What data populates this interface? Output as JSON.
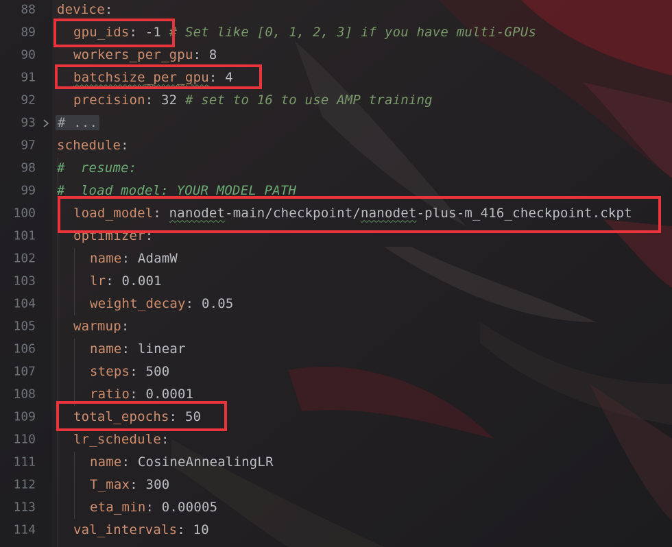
{
  "lines": [
    {
      "n": "88",
      "key": "device",
      "sep": ":",
      "val": "",
      "comment": ""
    },
    {
      "n": "89",
      "key": "gpu_ids",
      "sep": ":",
      "val": " -1",
      "comment": " # Set like [0, 1, 2, 3] if you have multi-GPUs"
    },
    {
      "n": "90",
      "key": "workers_per_gpu",
      "sep": ":",
      "val": " 8",
      "comment": ""
    },
    {
      "n": "91",
      "key": "batchsize_per_gpu",
      "sep": ":",
      "val": " 4",
      "comment": ""
    },
    {
      "n": "92",
      "key": "precision",
      "sep": ":",
      "val": " 32",
      "comment": " # set to 16 to use AMP training"
    },
    {
      "n": "93",
      "collapsed": "# ..."
    },
    {
      "n": "97",
      "key": "schedule",
      "sep": ":",
      "val": "",
      "comment": ""
    },
    {
      "n": "98",
      "comment_line": "#  resume:"
    },
    {
      "n": "99",
      "comment_line": "#  load_model: YOUR_MODEL_PATH"
    },
    {
      "n": "100",
      "key": "load_model",
      "sep": ":",
      "val_a": "nanodet",
      "val_b": "-main/checkpoint/",
      "val_c": "nanodet",
      "val_d": "-plus-m_416_checkpoint.ckpt"
    },
    {
      "n": "101",
      "key": "optimizer",
      "sep": ":",
      "val": ""
    },
    {
      "n": "102",
      "key": "name",
      "sep": ":",
      "val": " AdamW"
    },
    {
      "n": "103",
      "key": "lr",
      "sep": ":",
      "val": " 0.001"
    },
    {
      "n": "104",
      "key": "weight_decay",
      "sep": ":",
      "val": " 0.05"
    },
    {
      "n": "105",
      "key": "warmup",
      "sep": ":",
      "val": ""
    },
    {
      "n": "106",
      "key": "name",
      "sep": ":",
      "val": " linear"
    },
    {
      "n": "107",
      "key": "steps",
      "sep": ":",
      "val": " 500"
    },
    {
      "n": "108",
      "key": "ratio",
      "sep": ":",
      "val": " 0.0001"
    },
    {
      "n": "109",
      "key": "total_epochs",
      "sep": ":",
      "val": " 50"
    },
    {
      "n": "110",
      "key": "lr_schedule",
      "sep": ":",
      "val": ""
    },
    {
      "n": "111",
      "key": "name",
      "sep": ":",
      "val": " CosineAnnealingLR"
    },
    {
      "n": "112",
      "key": "T_max",
      "sep": ":",
      "val": " 300"
    },
    {
      "n": "113",
      "key": "eta_min",
      "sep": ":",
      "val": " 0.00005"
    },
    {
      "n": "114",
      "key": "val_intervals",
      "sep": ":",
      "val": " 10"
    }
  ],
  "colors": {
    "highlight_box": "#e8343a",
    "key": "#cf8e6d",
    "comment": "#7a9a6a",
    "line_number": "#6f737a"
  },
  "icons": {
    "fold": "chevron-right-icon"
  }
}
